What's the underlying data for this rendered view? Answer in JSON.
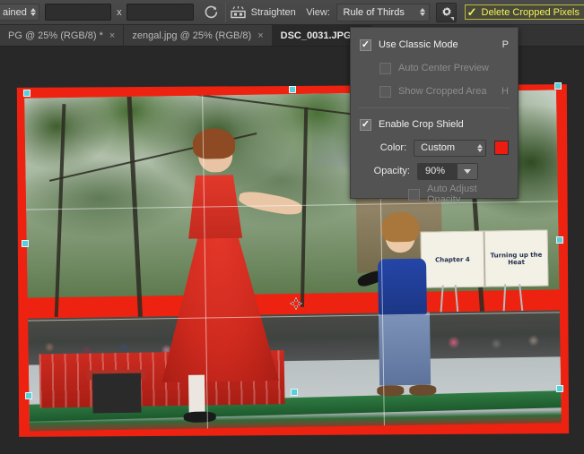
{
  "options_bar": {
    "ratio_select_value": "ained",
    "width_value": "",
    "height_value": "",
    "x_separator": "x",
    "swap_icon": "swap-rotate-icon",
    "straighten_icon": "straighten-icon",
    "straighten_label": "Straighten",
    "view_label": "View:",
    "view_value": "Rule of Thirds",
    "gear_icon": "gear-icon",
    "delete_cropped_checked": true,
    "delete_cropped_label": "Delete Cropped Pixels"
  },
  "tabs": [
    {
      "label": "PG @ 25% (RGB/8) *",
      "close": "×",
      "active": false
    },
    {
      "label": "zengal.jpg @ 25% (RGB/8)",
      "close": "×",
      "active": false
    },
    {
      "label": "DSC_0031.JPG @",
      "close": "",
      "active": true
    }
  ],
  "crop_panel": {
    "use_classic_mode": {
      "label": "Use Classic Mode",
      "shortcut": "P",
      "checked": true,
      "enabled": true
    },
    "auto_center_preview": {
      "label": "Auto Center Preview",
      "shortcut": "",
      "checked": false,
      "enabled": false
    },
    "show_cropped_area": {
      "label": "Show Cropped Area",
      "shortcut": "H",
      "checked": false,
      "enabled": false
    },
    "enable_crop_shield": {
      "label": "Enable Crop Shield",
      "shortcut": "",
      "checked": true,
      "enabled": true
    },
    "color_label": "Color:",
    "color_value": "Custom",
    "color_swatch_hex": "#ee1c10",
    "opacity_label": "Opacity:",
    "opacity_value": "90%",
    "auto_adjust_opacity": {
      "label": "Auto Adjust Opacity",
      "shortcut": "",
      "checked": false,
      "enabled": false
    }
  },
  "canvas": {
    "shield_color": "#ee2211",
    "handle_color": "#57d0dc",
    "grid_overlay": "Rule of Thirds",
    "sign_page_left": "Chapter 4",
    "sign_page_right": "Turning up the Heat",
    "photo_description": "Two women on an outdoor stage, one in a red dress, one in a blue t-shirt and jeans, beside an easel with a flip chart"
  }
}
